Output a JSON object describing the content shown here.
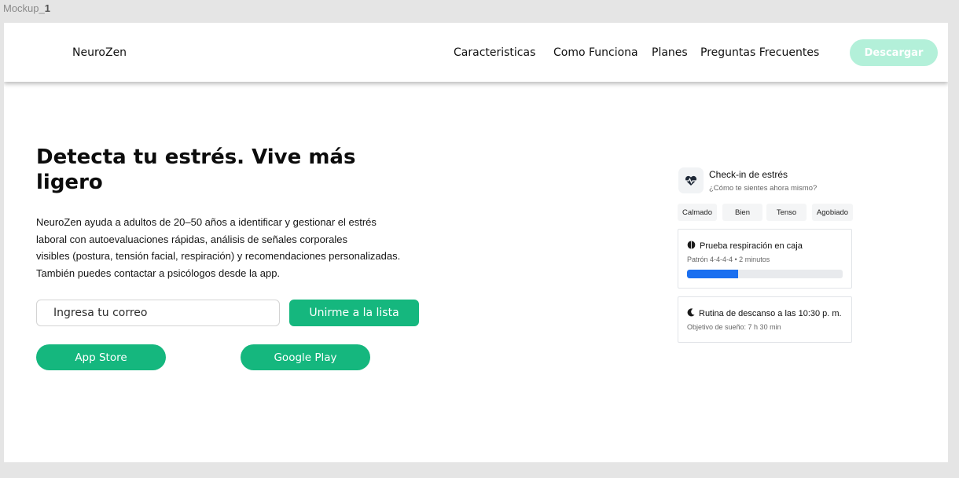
{
  "frame": {
    "label_prefix": "Mockup_",
    "label_suffix": "1"
  },
  "nav": {
    "brand": "NeuroZen",
    "links": [
      "Caracteristicas",
      "Como Funciona",
      "Planes",
      "Preguntas Frecuentes"
    ],
    "download_label": "Descargar"
  },
  "hero": {
    "title": "Detecta tu estrés. Vive más ligero",
    "description_lines": [
      "NeuroZen ayuda a adultos de 20–50 años a identificar y gestionar el estrés",
      "laboral con autoevaluaciones rápidas, análisis de señales corporales",
      "visibles (postura, tensión facial, respiración) y recomendaciones personalizadas.",
      "También puedes contactar a psicólogos desde la app."
    ],
    "email_placeholder": "Ingresa tu correo",
    "join_label": "Unirme a la lista",
    "app_store_label": "App Store",
    "google_play_label": "Google Play"
  },
  "checkin": {
    "icon": "heart-pulse-icon",
    "title": "Check-in de estrés",
    "subtitle": "¿Cómo te sientes ahora mismo?",
    "moods": [
      "Calmado",
      "Bien",
      "Tenso",
      "Agobiado"
    ]
  },
  "breathing": {
    "icon": "brain-icon",
    "title": "Prueba respiración en caja",
    "subtitle": "Patrón 4-4-4-4 • 2 minutos",
    "progress": 0.33,
    "progress_color": "#1a6ff0"
  },
  "rest": {
    "icon": "moon-icon",
    "title": "Rutina de descanso a las 10:30 p. m.",
    "subtitle": "Objetivo de sueño: 7 h 30 min"
  },
  "colors": {
    "accent": "#15b77e",
    "accent_light": "#b3f0d9"
  }
}
